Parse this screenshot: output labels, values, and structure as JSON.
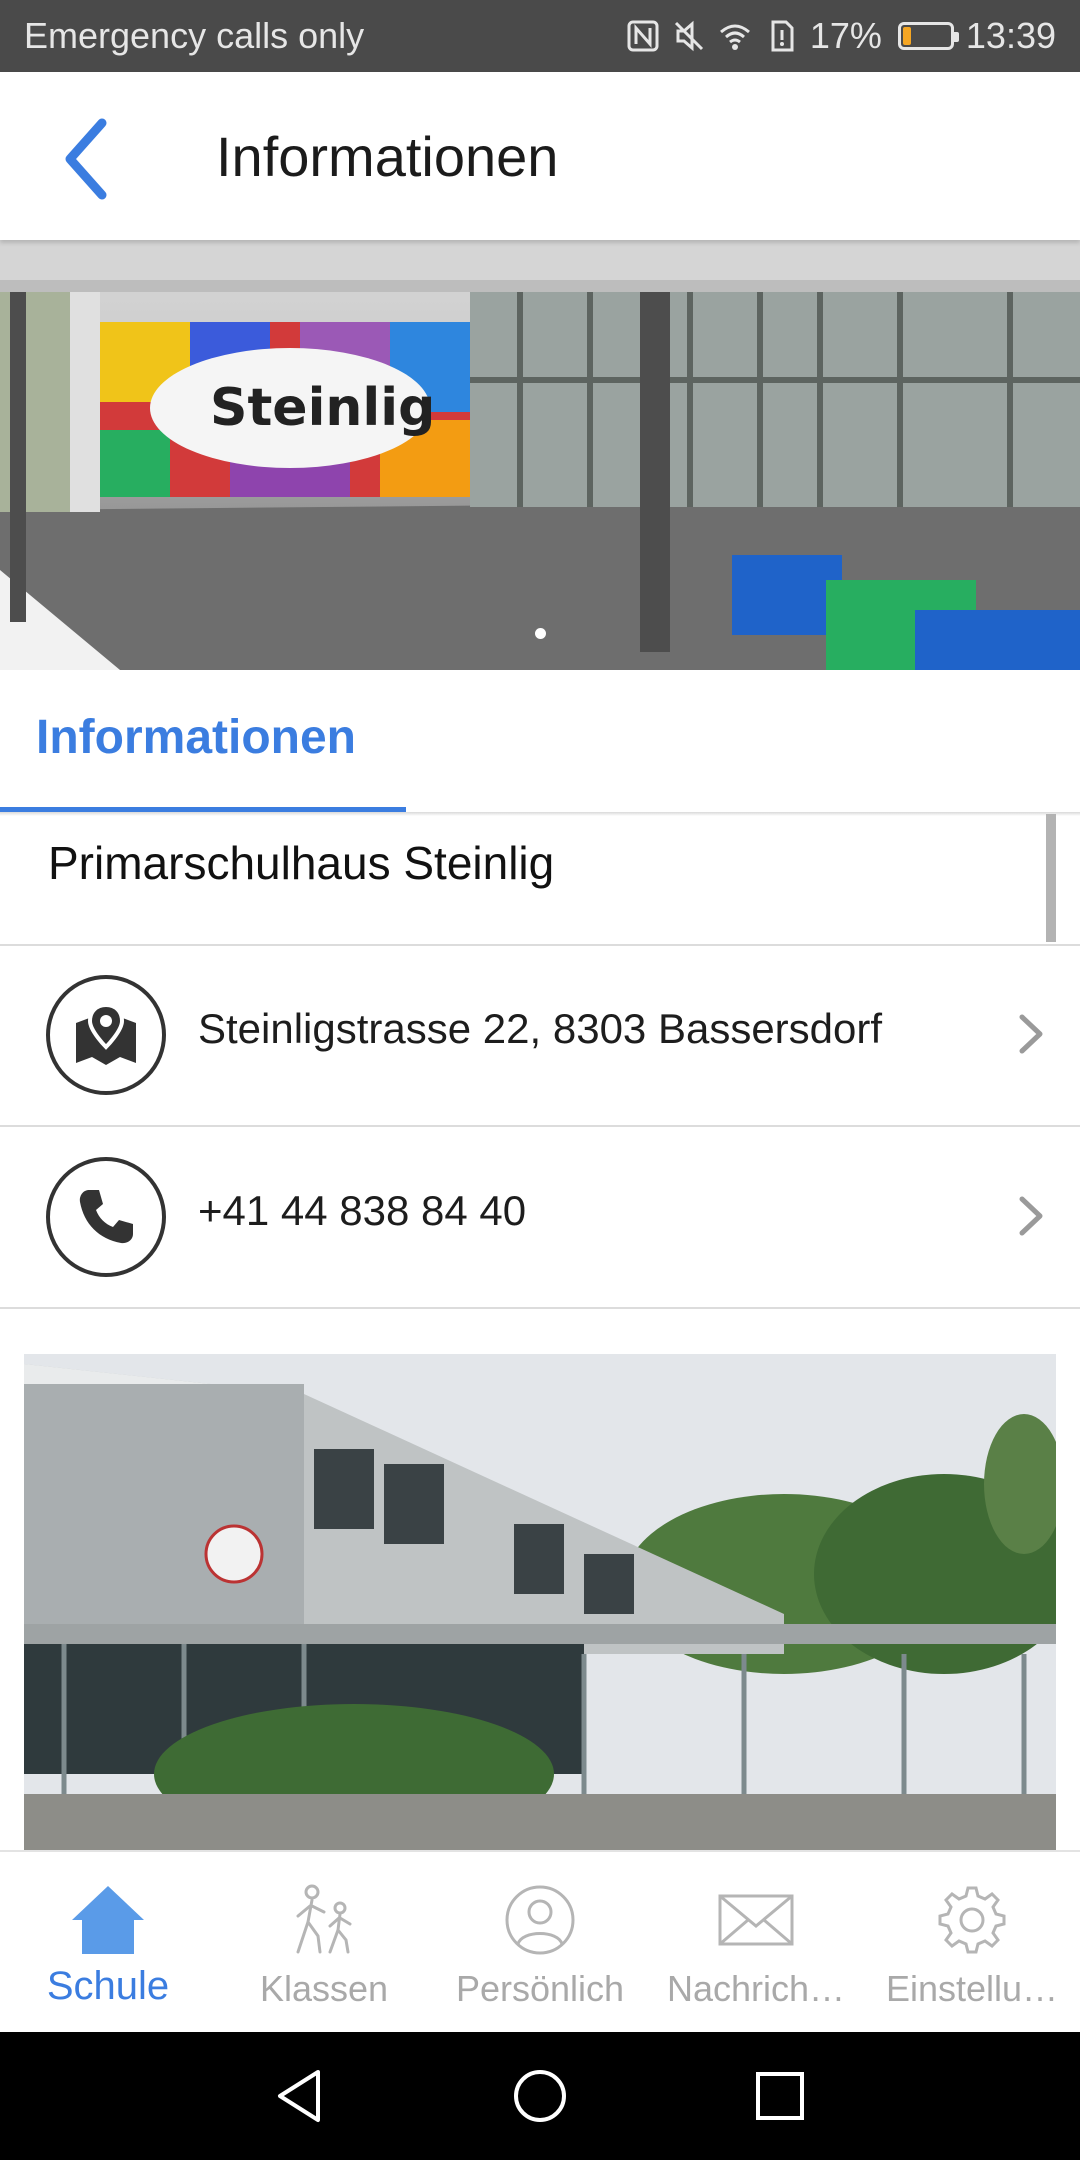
{
  "status_bar": {
    "carrier_text": "Emergency calls only",
    "battery_text": "17%",
    "battery_level": 0.17,
    "time": "13:39",
    "icons": [
      "nfc-icon",
      "mute-icon",
      "wifi-icon",
      "sim-icon",
      "battery-icon"
    ]
  },
  "app_bar": {
    "title": "Informationen",
    "back_icon": "chevron-left-icon"
  },
  "hero": {
    "mural_text": "Steinlig",
    "pager_dots": 1,
    "active_dot": 0
  },
  "tabs": [
    {
      "label": "Informationen",
      "active": true
    }
  ],
  "info": {
    "school_name": "Primarschulhaus Steinlig",
    "address": {
      "icon": "map-pin-icon",
      "text": "Steinligstrasse 22, 8303 Bassersdorf"
    },
    "phone": {
      "icon": "phone-icon",
      "text": "+41 44 838 84 40"
    }
  },
  "bottom_nav": [
    {
      "label": "Schule",
      "icon": "home-icon",
      "active": true
    },
    {
      "label": "Klassen",
      "icon": "walking-people-icon",
      "active": false
    },
    {
      "label": "Persönlich",
      "icon": "person-icon",
      "active": false
    },
    {
      "label": "Nachrich…",
      "icon": "envelope-icon",
      "active": false
    },
    {
      "label": "Einstellu…",
      "icon": "gear-icon",
      "active": false
    }
  ],
  "colors": {
    "accent": "#3b7de0",
    "status_bar": "#4a4a4a",
    "inactive_nav": "#a9a9a9"
  }
}
